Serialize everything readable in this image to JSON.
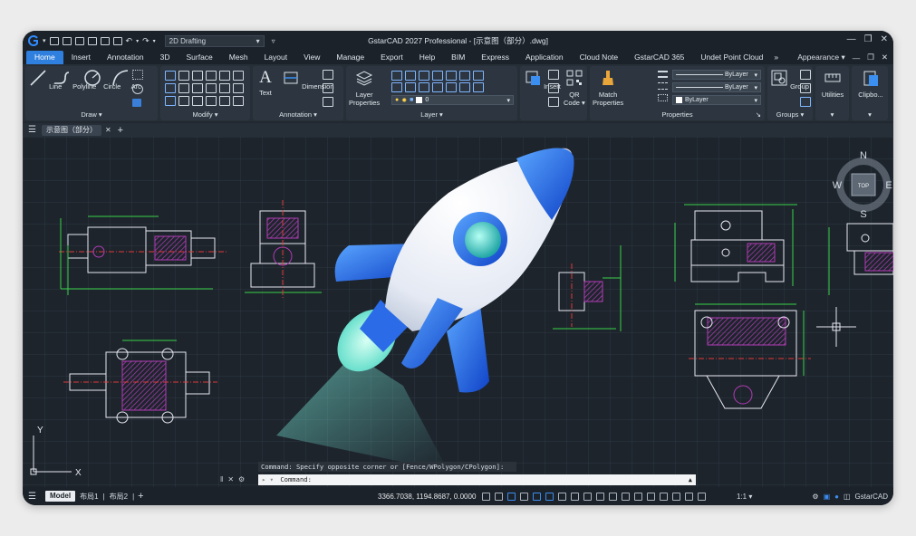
{
  "app": {
    "title": "GstarCAD 2027 Professional - [示意图（部分）.dwg]",
    "workspace": "2D Drafting"
  },
  "menu": {
    "tabs": [
      "Home",
      "Insert",
      "Annotation",
      "3D",
      "Surface",
      "Mesh",
      "Layout",
      "View",
      "Manage",
      "Export",
      "Help",
      "BIM",
      "Express",
      "Application",
      "Cloud Note",
      "GstarCAD 365",
      "Undet Point Cloud"
    ],
    "more": "»",
    "appearance": "Appearance ▾"
  },
  "ribbon": {
    "draw": {
      "line": "Line",
      "polyline": "Polyline",
      "circle": "Circle",
      "arc": "Arc",
      "title": "Draw ▾"
    },
    "modify": {
      "title": "Modify ▾"
    },
    "annotation": {
      "text": "Text",
      "dimension": "Dimension",
      "title": "Annotation ▾"
    },
    "layer": {
      "layer_properties_1": "Layer",
      "layer_properties_2": "Properties",
      "current_layer": "0",
      "title": "Layer ▾"
    },
    "block": {
      "insert": "Insert",
      "qr_1": "QR",
      "qr_2": "Code ▾"
    },
    "properties": {
      "match_1": "Match",
      "match_2": "Properties",
      "color": "ByLayer",
      "linetype": "ByLayer",
      "lineweight": "ByLayer",
      "title": "Properties",
      "expand": "↘"
    },
    "groups": {
      "group": "Group",
      "title": "Groups ▾"
    },
    "utilities": {
      "label": "Utilities",
      "title": "▾"
    },
    "clipboard": {
      "label": "Clipbo...",
      "title": "▾"
    }
  },
  "file_tabs": {
    "doc": "示意图（部分）",
    "close": "✕",
    "add": "+"
  },
  "viewcube": {
    "n": "N",
    "s": "S",
    "e": "E",
    "w": "W",
    "top": "TOP"
  },
  "ucs": {
    "x": "X",
    "y": "Y"
  },
  "command": {
    "history": "Command: Specify opposite corner or [Fence/WPolygon/CPolygon]:",
    "prompt": "Command:",
    "prompt_prefix": "▸ ▾"
  },
  "status": {
    "tabs": [
      "Model",
      "布局1",
      "布局2"
    ],
    "add": "+",
    "coords": "3366.7038, 1194.8687, 0.0000",
    "scale": "1:1 ▾",
    "brand": "GstarCAD"
  },
  "colors": {
    "accent": "#2f7fde",
    "background": "#1d242c",
    "drawing_line": "#e8e8f0",
    "dimension": "#39d24a",
    "hatch": "#b23cb6",
    "center": "#e03a3a"
  }
}
